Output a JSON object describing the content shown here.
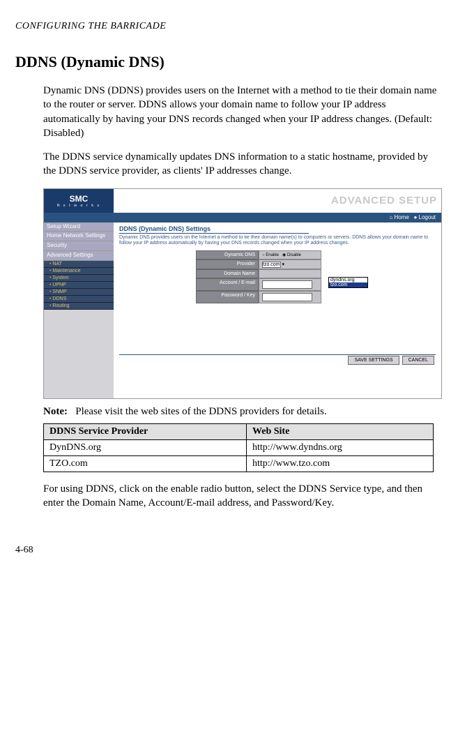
{
  "running_header": "CONFIGURING THE BARRICADE",
  "section_title": "DDNS (Dynamic DNS)",
  "para1": "Dynamic DNS (DDNS) provides users on the Internet with a method to tie their domain name to the router or server. DDNS allows your domain name to follow your IP address automatically by having your DNS records changed when your IP address changes. (Default: Disabled)",
  "para2": "The DDNS service dynamically updates DNS information to a static hostname, provided by the DDNS service provider, as clients' IP addresses change.",
  "screenshot": {
    "logo": "SMC",
    "logo_sub": "N e t w o r k s",
    "brand_text": "ADVANCED SETUP",
    "home_label": "Home",
    "logout_label": "Logout",
    "sidebar_groups": [
      "Setup Wizard",
      "Home Network Settings",
      "Security",
      "Advanced Settings"
    ],
    "sidebar_items": [
      "NAT",
      "Maintenance",
      "System",
      "UPNP",
      "SNMP",
      "DDNS",
      "Routing"
    ],
    "panel_title": "DDNS (Dynamic DNS) Settings",
    "panel_desc": "Dynamic DNS provides users on the Internet a method to tie their domain name(s) to computers or servers. DDNS allows your domain name to follow your IP address automatically by having your DNS records changed when your IP address changes.",
    "labels": {
      "dynamic_dns": "Dynamic DNS",
      "provider": "Provider",
      "domain_name": "Domain Name",
      "account": "Account / E-mail",
      "password": "Password / Key"
    },
    "radio_enable": "Enable",
    "radio_disable": "Disable",
    "provider_selected": "tzo.com",
    "provider_options": [
      "dyndns.org",
      "tzo.com"
    ],
    "save_btn": "SAVE SETTINGS",
    "cancel_btn": "CANCEL"
  },
  "note_label": "Note:",
  "note_text": "Please visit the web sites of the DDNS providers for details.",
  "table": {
    "headers": [
      "DDNS Service Provider",
      "Web Site"
    ],
    "rows": [
      [
        "DynDNS.org",
        "http://www.dyndns.org"
      ],
      [
        "TZO.com",
        "http://www.tzo.com"
      ]
    ]
  },
  "para3": "For using DDNS, click on the enable radio button, select the DDNS Service type, and then enter the Domain Name, Account/E-mail address, and Password/Key.",
  "page_number": "4-68"
}
